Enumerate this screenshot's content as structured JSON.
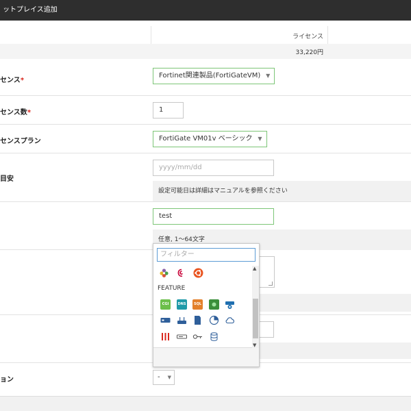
{
  "header": {
    "title": "ットプレイス追加"
  },
  "price": {
    "column_header": "ライセンス",
    "value": "33,220円"
  },
  "fields": {
    "license": {
      "label": "センス",
      "required_mark": "*",
      "value": "Fortinet関連製品(FortiGateVM)"
    },
    "license_count": {
      "label": "センス数",
      "required_mark": "*",
      "value": "1"
    },
    "license_plan": {
      "label": "センスプラン",
      "value": "FortiGate VM01v ベーシック"
    },
    "date": {
      "label": "目安",
      "placeholder": "yyyy/mm/dd",
      "help": "設定可能日は詳細はマニュアルを参照ください"
    },
    "name": {
      "value": "test",
      "help": "任意, 1〜64文字"
    },
    "option": {
      "label": "ョン",
      "value": "-"
    }
  },
  "icon_picker": {
    "filter_placeholder": "フィルター",
    "section_label": "FEATURE",
    "os_icons": [
      "blossom-icon",
      "debian-icon",
      "ubuntu-icon"
    ],
    "feature_icons": [
      {
        "name": "cgi-icon",
        "text": "CGI",
        "color": "#6cbf4a"
      },
      {
        "name": "dns-icon",
        "text": "DNS",
        "color": "#1f9aa8"
      },
      {
        "name": "sql-icon",
        "text": "SQL",
        "color": "#e3802a"
      },
      {
        "name": "network-icon",
        "text": "",
        "color": "#3a8f3a"
      },
      {
        "name": "switch-icon",
        "text": "",
        "color": "#1f6fb0"
      }
    ],
    "device_icons": [
      "server-icon",
      "router-icon",
      "storage-icon",
      "pie-chart-icon",
      "cloud-icon",
      "firewall-icon",
      "nas-icon",
      "key-icon",
      "database-icon"
    ]
  },
  "colors": {
    "accent_border": "#7cc576",
    "header_bg": "#2e2e2e",
    "required": "#d9261c"
  }
}
